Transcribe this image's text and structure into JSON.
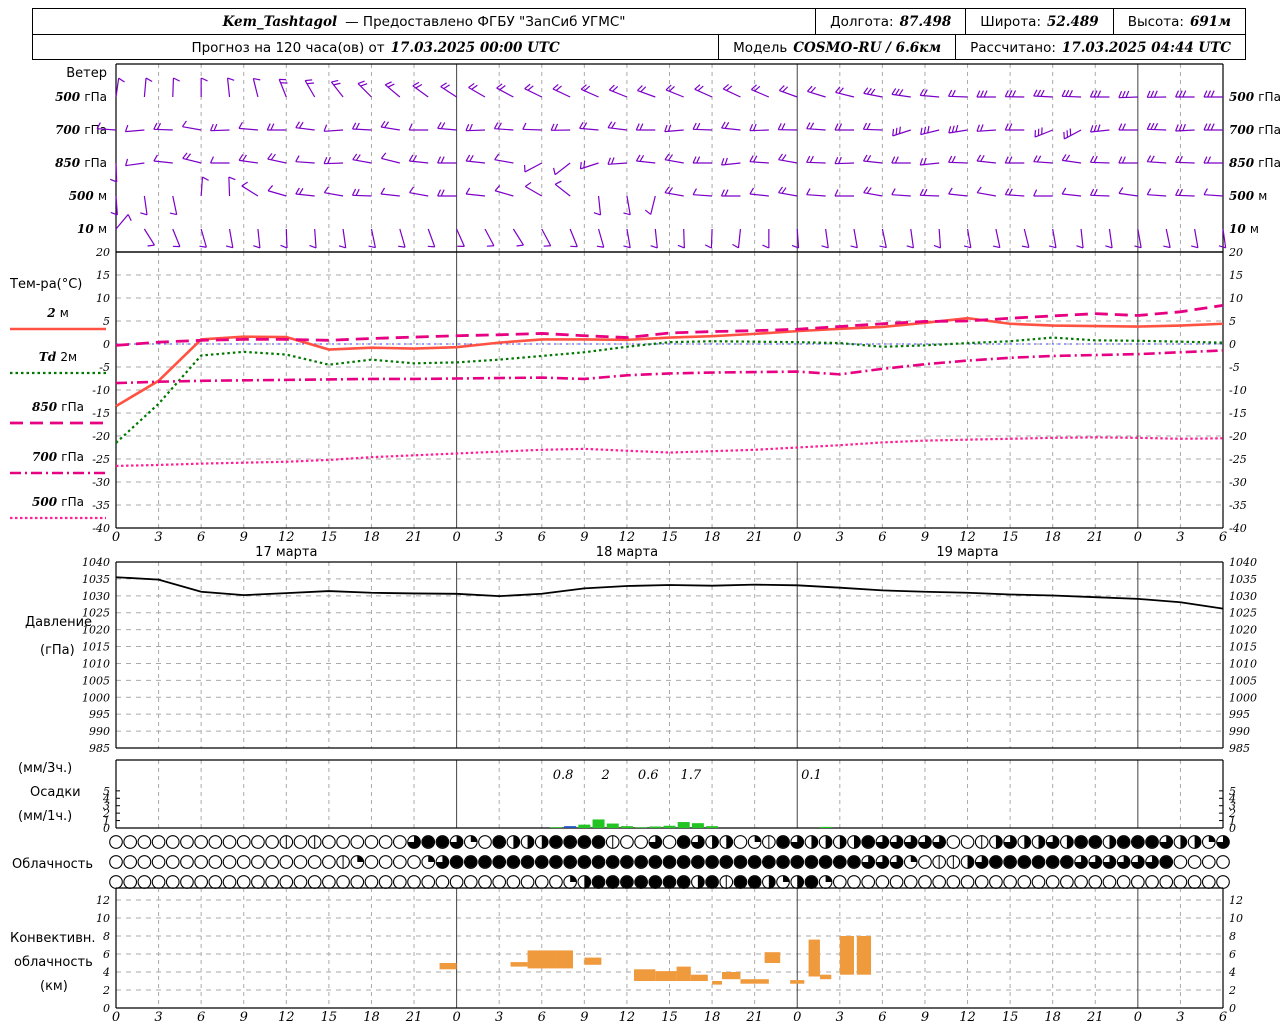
{
  "header": {
    "row1": {
      "station": "Kem_Tashtagol",
      "provider": "— Предоставлено ФГБУ \"ЗапСиб УГМС\"",
      "lon_label": "Долгота:",
      "lon_value": "87.498",
      "lat_label": "Широта:",
      "lat_value": "52.489",
      "alt_label": "Высота:",
      "alt_value": "691м"
    },
    "row2": {
      "forecast_label": "Прогноз на 120 часа(ов) от",
      "run_time": "17.03.2025 00:00 UTC",
      "model_label": "Модель",
      "model_value": "COSMO-RU / 6.6км",
      "calc_label": "Рассчитано:",
      "calc_time": "17.03.2025 04:44 UTC"
    }
  },
  "colors": {
    "barb": "#7d00c8",
    "t2m": "#ff5242",
    "td2m": "#007700",
    "t850": "#e80082",
    "t700": "#e80082",
    "t500": "#ff1e96",
    "zero": "#3b3bff",
    "pressure": "#000000",
    "rain": "#21c421",
    "mixed": "#1e56c8",
    "conv": "#f09a3e",
    "grid": "#aaaaaa",
    "dayline": "#444444"
  },
  "axis": {
    "hours_total": 78,
    "hour_step": 3,
    "dates": [
      "17 марта",
      "18 марта",
      "19 марта"
    ]
  },
  "chart_data": [
    {
      "id": "wind",
      "type": "wind-barbs",
      "title": "Ветер",
      "levels": [
        {
          "it": "500",
          "rest": "гПа"
        },
        {
          "it": "700",
          "rest": "гПа"
        },
        {
          "it": "850",
          "rest": "гПа"
        },
        {
          "it": "500",
          "rest": "м"
        },
        {
          "it": "10",
          "rest": "м"
        }
      ],
      "rows": [
        {
          "angles": [
            8,
            5,
            2,
            0,
            -6,
            -14,
            -22,
            -30,
            -38,
            -45,
            -50,
            -54,
            -57,
            -60,
            -62,
            -64,
            -65,
            -66,
            -68,
            -70,
            -68,
            -66,
            -65,
            -67,
            -70,
            -73,
            -76,
            -79,
            -82,
            -85,
            -88,
            -90,
            -89,
            -87,
            -88,
            -90,
            -92,
            -91,
            -90,
            -90
          ],
          "feathers": [
            1,
            1,
            1,
            1,
            1,
            1,
            2,
            2,
            2,
            2,
            2,
            2,
            2,
            2,
            2,
            2,
            2,
            2,
            2,
            2,
            2,
            2,
            2,
            2,
            2,
            2,
            2,
            3,
            3,
            2,
            2,
            3,
            3,
            3,
            3,
            3,
            3,
            3,
            3,
            3
          ]
        },
        {
          "angles": [
            -86,
            -95,
            -88,
            -80,
            -92,
            -85,
            -90,
            -83,
            -94,
            -87,
            -81,
            -90,
            -85,
            -92,
            -86,
            -88,
            -91,
            -85,
            -83,
            -90,
            -95,
            -88,
            -84,
            -92,
            -89,
            -86,
            -90,
            -88,
            -108,
            -104,
            -99,
            -94,
            -90,
            -112,
            -118,
            -96,
            -90,
            -88,
            -93,
            -90
          ],
          "feathers": [
            1,
            1,
            2,
            1,
            2,
            1,
            2,
            2,
            1,
            2,
            2,
            1,
            2,
            2,
            2,
            1,
            2,
            2,
            2,
            2,
            2,
            2,
            2,
            2,
            2,
            2,
            2,
            2,
            3,
            3,
            3,
            2,
            2,
            3,
            3,
            3,
            2,
            3,
            3,
            3
          ]
        },
        {
          "angles": [
            178,
            -98,
            -84,
            -76,
            -90,
            -82,
            -78,
            -86,
            -92,
            -80,
            -76,
            -84,
            -90,
            -84,
            -80,
            -118,
            -128,
            -108,
            -94,
            -84,
            -80,
            -90,
            -96,
            -86,
            -80,
            -88,
            -92,
            -84,
            -90,
            -96,
            -88,
            -84,
            -90,
            -86,
            -82,
            -88,
            -90,
            -86,
            -88,
            -90
          ],
          "feathers": [
            1,
            1,
            1,
            2,
            1,
            2,
            2,
            1,
            2,
            2,
            1,
            2,
            2,
            2,
            1,
            1,
            1,
            2,
            2,
            2,
            2,
            2,
            2,
            2,
            2,
            2,
            2,
            2,
            2,
            2,
            2,
            2,
            2,
            2,
            2,
            2,
            2,
            2,
            2,
            2
          ]
        },
        {
          "angles": [
            176,
            172,
            168,
            4,
            -2,
            -58,
            -74,
            -84,
            -80,
            -88,
            -84,
            -80,
            -90,
            -84,
            -74,
            -60,
            -52,
            174,
            170,
            -166,
            -80,
            -86,
            -90,
            -84,
            -80,
            -86,
            -90,
            -80,
            -86,
            -88,
            -84,
            -80,
            -86,
            -90,
            -84,
            -88,
            -82,
            -86,
            -88,
            -86
          ],
          "feathers": [
            1,
            1,
            1,
            1,
            1,
            1,
            1,
            2,
            1,
            2,
            1,
            1,
            2,
            1,
            1,
            1,
            1,
            1,
            1,
            1,
            2,
            1,
            2,
            1,
            2,
            1,
            1,
            2,
            1,
            2,
            1,
            1,
            2,
            1,
            1,
            2,
            1,
            1,
            2,
            1
          ]
        },
        {
          "angles": [
            40,
            148,
            158,
            164,
            170,
            174,
            178,
            176,
            172,
            168,
            164,
            160,
            156,
            152,
            148,
            152,
            158,
            164,
            170,
            174,
            178,
            -178,
            -174,
            180,
            176,
            172,
            170,
            168,
            172,
            176,
            170,
            168,
            166,
            170,
            174,
            172,
            170,
            168,
            170,
            172
          ],
          "feathers": [
            1,
            1,
            1,
            1,
            1,
            1,
            1,
            1,
            1,
            1,
            1,
            1,
            1,
            1,
            1,
            1,
            1,
            1,
            1,
            1,
            1,
            1,
            1,
            1,
            1,
            1,
            1,
            1,
            1,
            1,
            1,
            1,
            1,
            1,
            1,
            1,
            1,
            1,
            1,
            1
          ]
        }
      ]
    },
    {
      "id": "temperature",
      "type": "line",
      "title": "Тем-ра(°C)",
      "ylim": [
        -40,
        20
      ],
      "ytick": 5,
      "x_step": 3,
      "zero_line": true,
      "series": [
        {
          "name": "2м",
          "legend_it": "2",
          "legend_rest": "м",
          "style": "solid",
          "color_key": "t2m",
          "values": [
            -13.5,
            -8,
            1,
            1.6,
            1.5,
            -1.2,
            -0.8,
            -1,
            -0.7,
            0.3,
            1,
            1,
            0.9,
            1.4,
            1.7,
            2.2,
            2.8,
            3.3,
            3.7,
            4.6,
            5.6,
            4.4,
            4,
            3.9,
            3.8,
            4,
            4.4
          ]
        },
        {
          "name": "Td 2м",
          "legend_it": "Td",
          "legend_rest": "2м",
          "style": "dot",
          "color_key": "td2m",
          "values": [
            -21.5,
            -13,
            -2.5,
            -1.7,
            -2.3,
            -4.5,
            -3.4,
            -4.2,
            -4,
            -3.4,
            -2.6,
            -1.8,
            -0.6,
            0.4,
            0.6,
            0.5,
            0.4,
            0.2,
            -0.6,
            -0.3,
            0.2,
            0.6,
            1.4,
            0.8,
            0.7,
            0.5,
            0.3
          ]
        },
        {
          "name": "850 гПа",
          "legend_it": "850",
          "legend_rest": "гПа",
          "style": "longdash",
          "color_key": "t850",
          "values": [
            -0.3,
            0.4,
            0.8,
            1,
            1,
            0.8,
            1.2,
            1.5,
            1.8,
            2,
            2.3,
            1.8,
            1.4,
            2.4,
            2.7,
            2.9,
            3.2,
            3.8,
            4.4,
            4.9,
            5,
            5.6,
            6.1,
            6.6,
            6.2,
            7,
            8.4
          ]
        },
        {
          "name": "700 гПа",
          "legend_it": "700",
          "legend_rest": "гПа",
          "style": "dashdot",
          "color_key": "t700",
          "values": [
            -8.5,
            -8.2,
            -8,
            -7.9,
            -7.8,
            -7.7,
            -7.6,
            -7.6,
            -7.5,
            -7.4,
            -7.3,
            -7.6,
            -6.8,
            -6.4,
            -6.2,
            -6.1,
            -6,
            -6.6,
            -5.4,
            -4.4,
            -3.6,
            -3,
            -2.6,
            -2.4,
            -2.2,
            -1.8,
            -1.4
          ]
        },
        {
          "name": "500 гПа",
          "legend_it": "500",
          "legend_rest": "гПа",
          "style": "dot2",
          "color_key": "t500",
          "values": [
            -26.5,
            -26.3,
            -26,
            -25.8,
            -25.6,
            -25.2,
            -24.6,
            -24.2,
            -23.8,
            -23.4,
            -23,
            -22.8,
            -23.2,
            -23.6,
            -23.3,
            -23,
            -22.5,
            -22,
            -21.4,
            -21,
            -20.8,
            -20.6,
            -20.4,
            -20.3,
            -20.4,
            -20.6,
            -20.5
          ]
        }
      ]
    },
    {
      "id": "pressure",
      "type": "line",
      "label_lines": [
        "Давление",
        "(гПа)"
      ],
      "ylim": [
        985,
        1040
      ],
      "ytick": 5,
      "x_step": 3,
      "values": [
        1035.5,
        1034.8,
        1031.2,
        1030.2,
        1030.8,
        1031.4,
        1030.9,
        1030.7,
        1030.6,
        1029.9,
        1030.6,
        1032.2,
        1032.9,
        1033.2,
        1033,
        1033.3,
        1033.1,
        1032.4,
        1031.6,
        1031.2,
        1030.9,
        1030.4,
        1030.1,
        1029.6,
        1029.1,
        1028.1,
        1026.2
      ]
    },
    {
      "id": "precipitation",
      "type": "bar",
      "label_lines": [
        "(мм/3ч.)",
        "Осадки",
        "(мм/1ч.)"
      ],
      "ylim": [
        0,
        5
      ],
      "bars": [
        {
          "t": 31,
          "v": 0.1,
          "phase": "rain"
        },
        {
          "t": 32,
          "v": 0.25,
          "phase": "mixed"
        },
        {
          "t": 33,
          "v": 0.45,
          "phase": "rain"
        },
        {
          "t": 34,
          "v": 1.15,
          "phase": "rain"
        },
        {
          "t": 35,
          "v": 0.6,
          "phase": "rain"
        },
        {
          "t": 36,
          "v": 0.25,
          "phase": "rain"
        },
        {
          "t": 37,
          "v": 0.1,
          "phase": "rain"
        },
        {
          "t": 38,
          "v": 0.2,
          "phase": "rain"
        },
        {
          "t": 39,
          "v": 0.3,
          "phase": "rain"
        },
        {
          "t": 40,
          "v": 0.8,
          "phase": "rain"
        },
        {
          "t": 41,
          "v": 0.65,
          "phase": "rain"
        },
        {
          "t": 42,
          "v": 0.25,
          "phase": "rain"
        },
        {
          "t": 50,
          "v": 0.15,
          "phase": "rain"
        }
      ],
      "sum_labels": [
        {
          "t": 31.5,
          "text": "0.8"
        },
        {
          "t": 34.5,
          "text": "2"
        },
        {
          "t": 37.5,
          "text": "0.6"
        },
        {
          "t": 40.5,
          "text": "1.7"
        },
        {
          "t": 49,
          "text": "0.1"
        }
      ]
    },
    {
      "id": "cloudiness",
      "type": "symbols",
      "label": "Облачность",
      "rows": [
        [
          0,
          0,
          0,
          0,
          0,
          0,
          0,
          0,
          0,
          0,
          0,
          0,
          9,
          0,
          9,
          0,
          0,
          0,
          0,
          0,
          0,
          3,
          4,
          4,
          3,
          1,
          0,
          4,
          2,
          2,
          2,
          4,
          4,
          4,
          4,
          9,
          0,
          0,
          3,
          0,
          4,
          3,
          2,
          2,
          0,
          1,
          9,
          4,
          3,
          2,
          2,
          2,
          2,
          4,
          3,
          3,
          3,
          3,
          3,
          0,
          0,
          9,
          2,
          3,
          2,
          2,
          3,
          2,
          4,
          4,
          2,
          4,
          4,
          4,
          3,
          2,
          2,
          1,
          3
        ],
        [
          0,
          0,
          0,
          0,
          0,
          0,
          0,
          0,
          0,
          0,
          0,
          0,
          0,
          0,
          0,
          0,
          9,
          1,
          0,
          0,
          0,
          0,
          1,
          3,
          4,
          4,
          4,
          4,
          4,
          4,
          4,
          4,
          4,
          4,
          4,
          4,
          4,
          4,
          4,
          4,
          4,
          4,
          4,
          4,
          4,
          4,
          4,
          4,
          4,
          4,
          4,
          4,
          4,
          3,
          3,
          3,
          1,
          0,
          9,
          9,
          2,
          3,
          4,
          4,
          4,
          4,
          4,
          4,
          3,
          3,
          3,
          3,
          3,
          3,
          4,
          0,
          0,
          0,
          0
        ],
        [
          0,
          0,
          0,
          0,
          0,
          0,
          0,
          0,
          0,
          0,
          0,
          0,
          0,
          0,
          0,
          0,
          0,
          0,
          0,
          0,
          0,
          0,
          0,
          0,
          0,
          0,
          0,
          0,
          0,
          0,
          0,
          0,
          1,
          2,
          4,
          4,
          4,
          4,
          4,
          4,
          4,
          2,
          4,
          9,
          4,
          4,
          2,
          1,
          2,
          4,
          1,
          0,
          0,
          0,
          0,
          0,
          0,
          0,
          0,
          0,
          0,
          0,
          0,
          0,
          0,
          0,
          0,
          0,
          0,
          0,
          0,
          0,
          0,
          0,
          0,
          0,
          0,
          0,
          0
        ]
      ]
    },
    {
      "id": "convective",
      "type": "floating-bar",
      "label_lines": [
        "Конвективн.",
        "облачность",
        "(км)"
      ],
      "ylim": [
        0,
        12
      ],
      "ytick": 2,
      "bars": [
        [
          22.8,
          24,
          4.3,
          5
        ],
        [
          27.8,
          29,
          4.6,
          5.1
        ],
        [
          29,
          31,
          4.4,
          6.4
        ],
        [
          31,
          32.2,
          4.4,
          6.4
        ],
        [
          33,
          34.2,
          4.8,
          5.6
        ],
        [
          36.5,
          38,
          3,
          4.3
        ],
        [
          38,
          39.5,
          3,
          4.1
        ],
        [
          39.5,
          40.5,
          3,
          4.6
        ],
        [
          40.5,
          41.7,
          3,
          3.7
        ],
        [
          42,
          42.7,
          2.6,
          3
        ],
        [
          42.7,
          44,
          3.2,
          4
        ],
        [
          44,
          46,
          2.7,
          3.2
        ],
        [
          45.7,
          46.8,
          5,
          6.2
        ],
        [
          47.5,
          48.5,
          2.7,
          3.1
        ],
        [
          48.8,
          49.6,
          3.5,
          7.6
        ],
        [
          49.6,
          50.4,
          3.2,
          3.7
        ],
        [
          51,
          52,
          3.7,
          8
        ],
        [
          52.2,
          53.2,
          3.7,
          8
        ]
      ]
    }
  ]
}
